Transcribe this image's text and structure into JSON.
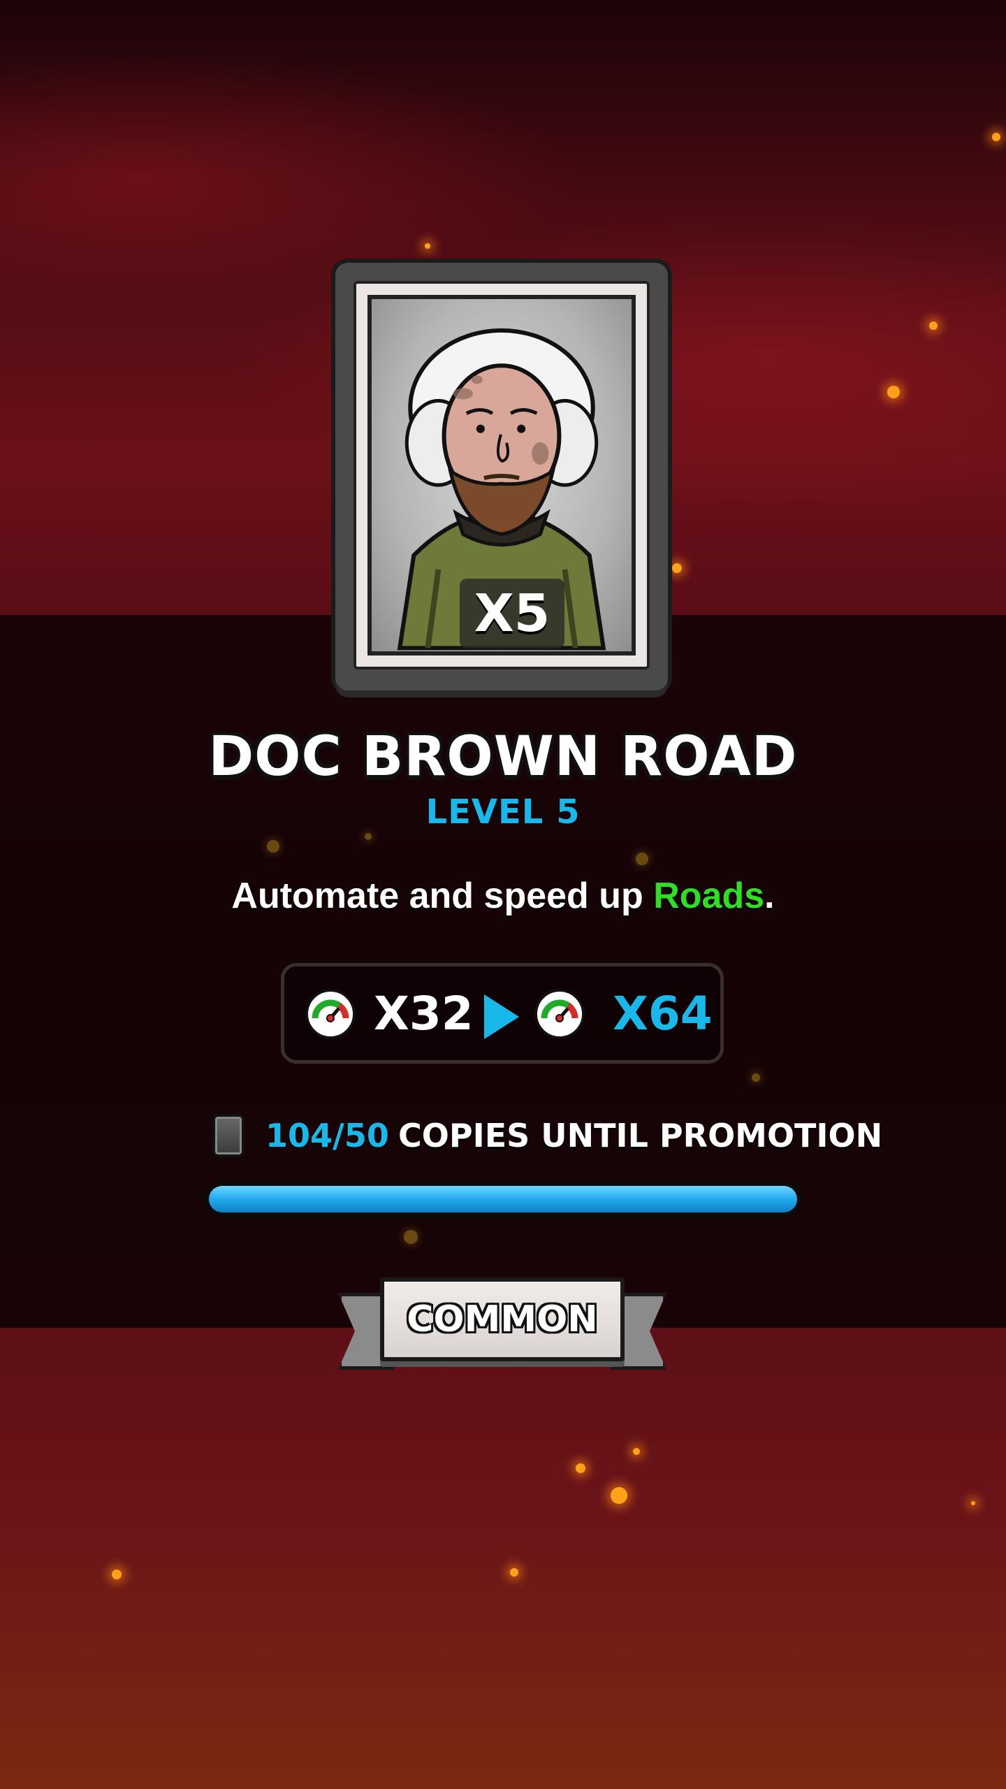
{
  "card": {
    "name": "DOC BROWN ROAD",
    "level_label": "LEVEL 5",
    "copies_badge": "X5",
    "description": {
      "prefix": "Automate and speed up ",
      "highlight": "Roads",
      "suffix": "."
    }
  },
  "stats": {
    "current_speed": "X32",
    "next_speed": "X64",
    "speed_icon": "speedometer-icon",
    "arrow_icon": "arrow-right-icon"
  },
  "promotion": {
    "count": "104/50",
    "label": "COPIES UNTIL PROMOTION",
    "progress_fraction": 1.0
  },
  "rarity": {
    "label": "COMMON"
  },
  "colors": {
    "accent_blue": "#19b8ea",
    "highlight_green": "#2fe022",
    "progress_blue": "#22a9ef"
  }
}
